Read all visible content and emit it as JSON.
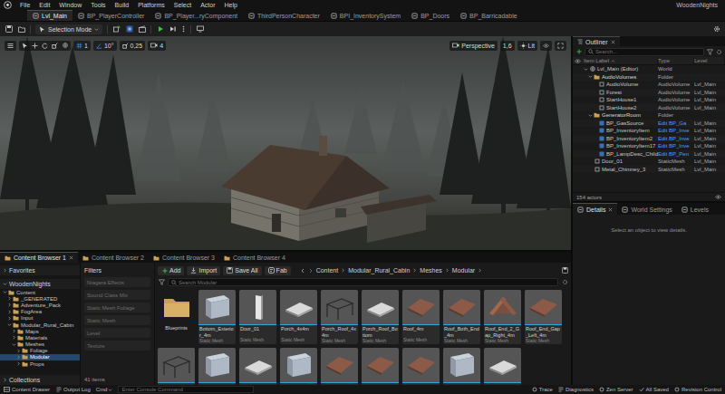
{
  "menu": {
    "items": [
      "File",
      "Edit",
      "Window",
      "Tools",
      "Build",
      "Platforms",
      "Select",
      "Actor",
      "Help"
    ],
    "project": "WoodenNights"
  },
  "document_tabs": [
    {
      "label": "Lvl_Main",
      "selected": true
    },
    {
      "label": "BP_PlayerController",
      "selected": false
    },
    {
      "label": "BP_Player...ryComponent",
      "selected": false
    },
    {
      "label": "ThirdPersonCharacter",
      "selected": false
    },
    {
      "label": "BPI_InventorySystem",
      "selected": false
    },
    {
      "label": "BP_Doors",
      "selected": false
    },
    {
      "label": "BP_Barricadable",
      "selected": false
    }
  ],
  "toolbar": {
    "mode": "Selection Mode"
  },
  "viewport": {
    "snaps": [
      "1",
      "10°",
      "0,25"
    ],
    "camera_speed": "4",
    "view": "Perspective",
    "value": "1,6",
    "view_mode": "Lit"
  },
  "outliner": {
    "title": "Outliner",
    "search": {
      "placeholder": "Search..."
    },
    "columns": [
      "Item Label",
      "Type",
      "Level"
    ],
    "rows": [
      {
        "label": "Lvl_Main (Editor)",
        "type": "World",
        "kind": "world",
        "depth": 0,
        "expanded": true
      },
      {
        "label": "AudioVolumes",
        "type": "Folder",
        "kind": "folder",
        "depth": 1,
        "expanded": true
      },
      {
        "label": "AudioVolume",
        "type": "AudioVolume",
        "level": "Lvl_Main",
        "kind": "actor",
        "depth": 2,
        "expanded": false
      },
      {
        "label": "Forest",
        "type": "AudioVolume",
        "level": "Lvl_Main",
        "kind": "actor",
        "depth": 2,
        "expanded": false
      },
      {
        "label": "StartHouse1",
        "type": "AudioVolume",
        "level": "Lvl_Main",
        "kind": "actor",
        "depth": 2,
        "expanded": false
      },
      {
        "label": "StartHouse2",
        "type": "AudioVolume",
        "level": "Lvl_Main",
        "kind": "actor",
        "depth": 2,
        "expanded": false
      },
      {
        "label": "GeneratorRoom",
        "type": "Folder",
        "kind": "folder",
        "depth": 1,
        "expanded": true
      },
      {
        "label": "BP_GasSource",
        "type": "Edit BP_Ga",
        "level": "Lvl_Main",
        "kind": "blueprint",
        "depth": 2,
        "expanded": false
      },
      {
        "label": "BP_InventoryItem",
        "type": "Edit BP_Inve",
        "level": "Lvl_Main",
        "kind": "blueprint",
        "depth": 2,
        "expanded": false
      },
      {
        "label": "BP_InventoryItem2",
        "type": "Edit BP_Inve",
        "level": "Lvl_Main",
        "kind": "blueprint",
        "depth": 2,
        "expanded": false
      },
      {
        "label": "BP_InventoryItem17",
        "type": "Edit BP_Inve",
        "level": "Lvl_Main",
        "kind": "blueprint",
        "depth": 2,
        "expanded": false
      },
      {
        "label": "BP_LampDesc_Child",
        "type": "Edit BP_Pen",
        "level": "Lvl_Main",
        "kind": "blueprint",
        "depth": 2,
        "expanded": false
      },
      {
        "label": "Door_01",
        "type": "StaticMesh",
        "level": "Lvl_Main",
        "kind": "actor",
        "depth": 1,
        "expanded": false
      },
      {
        "label": "Metal_Chimney_3",
        "type": "StaticMesh",
        "level": "Lvl_Main",
        "kind": "actor",
        "depth": 1,
        "expanded": false
      }
    ],
    "footer": "154 actors"
  },
  "details": {
    "tabs": [
      {
        "label": "Details",
        "selected": true
      },
      {
        "label": "World Settings",
        "selected": false
      },
      {
        "label": "Levels",
        "selected": false
      }
    ],
    "empty_text": "Select an object to view details."
  },
  "content_browser": {
    "tabs": [
      {
        "label": "Content Browser 1",
        "selected": true
      },
      {
        "label": "Content Browser 2",
        "selected": false
      },
      {
        "label": "Content Browser 3",
        "selected": false
      },
      {
        "label": "Content Browser 4",
        "selected": false
      }
    ],
    "sources": {
      "favorites": {
        "label": "Favorites",
        "expanded": false
      },
      "project": {
        "label": "WoodenNights",
        "expanded": true
      },
      "tree": [
        {
          "label": "Content",
          "depth": 0,
          "expanded": true,
          "selected": false
        },
        {
          "label": "_GENERATED",
          "depth": 1,
          "expanded": false,
          "selected": false
        },
        {
          "label": "Adventure_Pack",
          "depth": 1,
          "expanded": false,
          "selected": false
        },
        {
          "label": "FogArea",
          "depth": 1,
          "expanded": false,
          "selected": false
        },
        {
          "label": "Input",
          "depth": 1,
          "expanded": false,
          "selected": false
        },
        {
          "label": "Modular_Rural_Cabin",
          "depth": 1,
          "expanded": true,
          "selected": false
        },
        {
          "label": "Maps",
          "depth": 2,
          "expanded": false,
          "selected": false
        },
        {
          "label": "Materials",
          "depth": 2,
          "expanded": false,
          "selected": false
        },
        {
          "label": "Meshes",
          "depth": 2,
          "expanded": true,
          "selected": false
        },
        {
          "label": "Foliage",
          "depth": 3,
          "expanded": false,
          "selected": false
        },
        {
          "label": "Modular",
          "depth": 3,
          "expanded": false,
          "selected": true
        },
        {
          "label": "Props",
          "depth": 3,
          "expanded": false,
          "selected": false
        }
      ],
      "collections": {
        "label": "Collections",
        "expanded": false
      }
    },
    "filters": {
      "title": "Filters",
      "items": [
        {
          "label": "Niagara Effects",
          "active": false
        },
        {
          "label": "Sound Class Mix",
          "active": false
        },
        {
          "label": "Static Mesh Foliage",
          "active": false
        },
        {
          "label": "Static Mesh",
          "active": false
        },
        {
          "label": "Level",
          "active": false
        },
        {
          "label": "Texture",
          "active": false
        }
      ]
    },
    "toolbar": {
      "add": "Add",
      "import": "Import",
      "save_all": "Save All",
      "fab": "Fab"
    },
    "breadcrumb": [
      "Content",
      "Modular_Rural_Cabin",
      "Meshes",
      "Modular"
    ],
    "search": {
      "placeholder": "Search Modular"
    },
    "assets": [
      {
        "label": "Blueprints",
        "kind": "folder"
      },
      {
        "label": "Bottom_Exterior_4m",
        "type": "Static Mesh",
        "kind": "wall"
      },
      {
        "label": "Door_01",
        "type": "Static Mesh",
        "kind": "door"
      },
      {
        "label": "Porch_4x4m",
        "type": "Static Mesh",
        "kind": "floor"
      },
      {
        "label": "Porch_Roof_4x4m",
        "type": "Static Mesh",
        "kind": "frame"
      },
      {
        "label": "Porch_Roof_Bottom",
        "type": "Static Mesh",
        "kind": "floor"
      },
      {
        "label": "Roof_4m",
        "type": "Static Mesh",
        "kind": "roof"
      },
      {
        "label": "Roof_Both_End_4m",
        "type": "Static Mesh",
        "kind": "roof"
      },
      {
        "label": "Roof_End_2_Gap_Right_4m",
        "type": "Static Mesh",
        "kind": "gable"
      },
      {
        "label": "Roof_End_Gap_Left_4m",
        "type": "Static Mesh",
        "kind": "roof"
      }
    ],
    "more_assets": [
      "frame",
      "wall",
      "floor",
      "wall",
      "roof",
      "roof",
      "roof",
      "wall",
      "floor"
    ],
    "count": "41 items"
  },
  "status_bar": {
    "left": [
      "Content Drawer",
      "Output Log"
    ],
    "cmd": "Cmd",
    "console": {
      "placeholder": "Enter Console Command"
    },
    "right": [
      "Trace",
      "Diagnostics",
      "Zen Server",
      "All Saved",
      "Revision Control"
    ]
  }
}
